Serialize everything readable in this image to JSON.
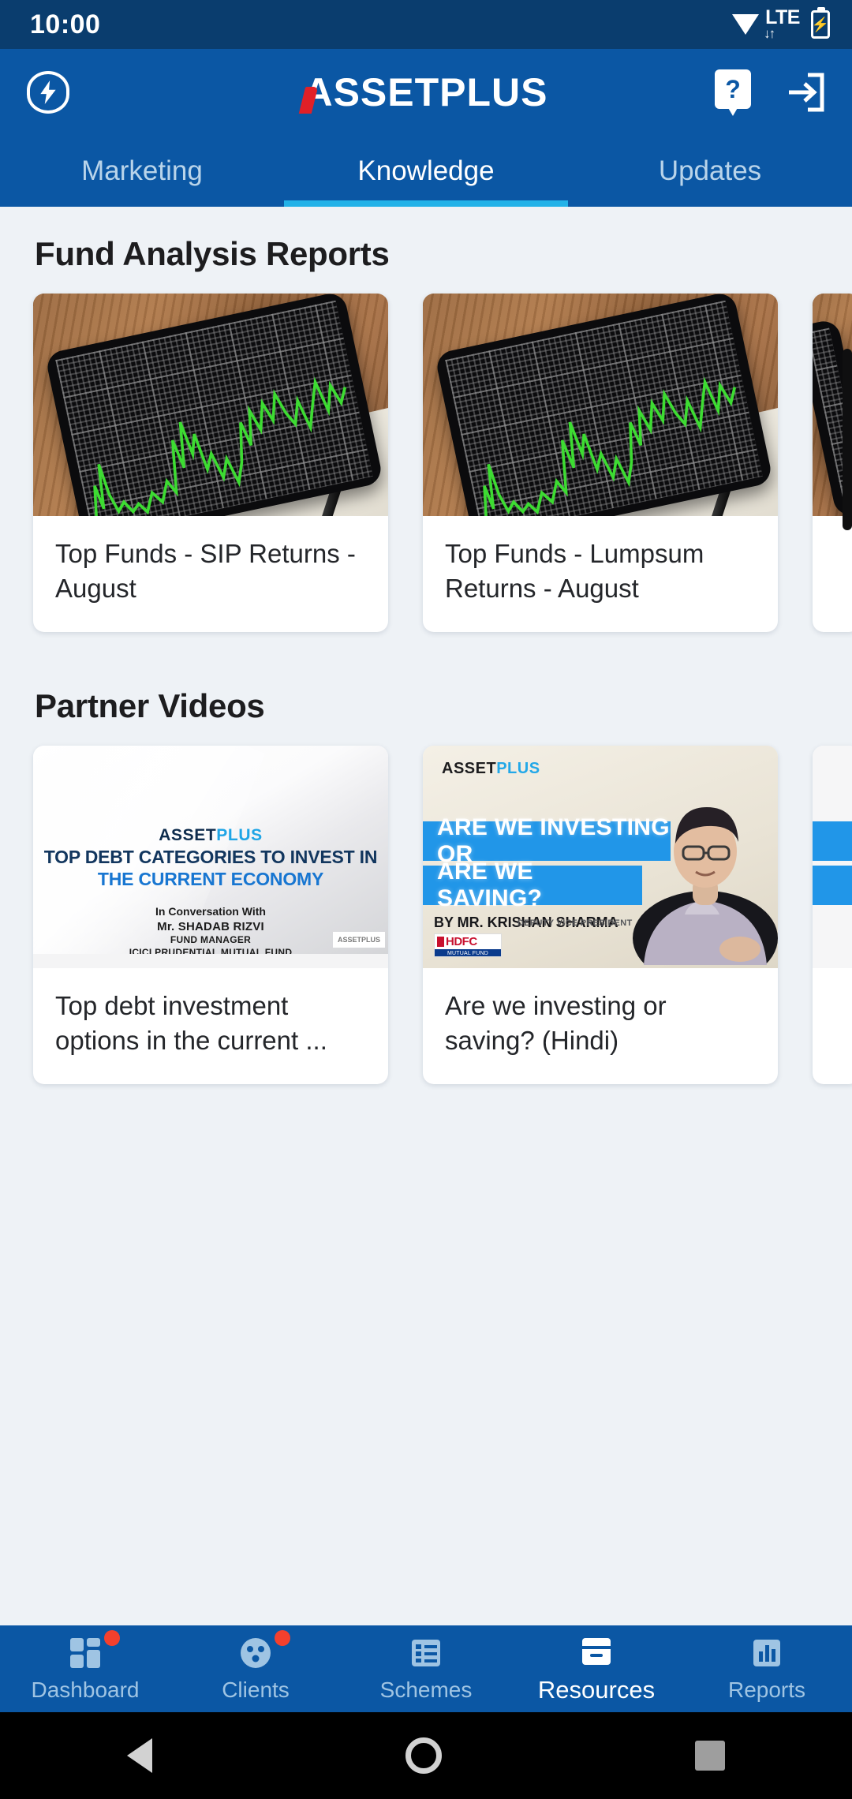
{
  "status_bar": {
    "time": "10:00",
    "network": "LTE",
    "wifi_icon": "wifi-icon",
    "battery_icon": "battery-charging-icon",
    "data_arrows": "↓↑"
  },
  "app_bar": {
    "menu_icon": "bolt-circle-icon",
    "brand_first": "ASSET",
    "brand_second": "PLUS",
    "brand_full": "ASSETPLUS",
    "help_icon": "help-question-icon",
    "help_label": "?",
    "logout_icon": "logout-icon"
  },
  "tabs": [
    {
      "label": "Marketing",
      "active": false
    },
    {
      "label": "Knowledge",
      "active": true
    },
    {
      "label": "Updates",
      "active": false
    }
  ],
  "sections": [
    {
      "title": "Fund Analysis Reports",
      "cards": [
        {
          "title": "Top Funds - SIP Returns - August",
          "thumb": "stock-chart-tablet-photo"
        },
        {
          "title": "Top Funds - Lumpsum Returns - August",
          "thumb": "stock-chart-tablet-photo"
        },
        {
          "title": "",
          "thumb": "stock-chart-tablet-photo"
        }
      ]
    },
    {
      "title": "Partner Videos",
      "cards": [
        {
          "title": "Top debt investment options in the current ...",
          "thumb": "video-slide-debt-categories",
          "slide": {
            "brand_a": "ASSET",
            "brand_p": "PLUS",
            "headline1": "TOP DEBT CATEGORIES TO INVEST IN",
            "headline2": "THE CURRENT ECONOMY",
            "credit_intro": "In Conversation With",
            "credit_name": "Mr. SHADAB RIZVI",
            "credit_role": "FUND MANAGER",
            "credit_org": "ICICI PRUDENTIAL MUTUAL FUND",
            "corner_logo": "ASSETPLUS"
          }
        },
        {
          "title": "Are we investing or saving? (Hindi)",
          "thumb": "video-slide-investing-saving",
          "slide": {
            "brand_a": "ASSET",
            "brand_p": "PLUS",
            "band1": "ARE WE INVESTING OR",
            "band2": "ARE WE SAVING?",
            "by_line": "BY MR. KRISHAN SHARMA",
            "designation": "DEPUTY VICE PRESIDENT",
            "logo_top": "HDFC",
            "logo_bottom": "MUTUAL FUND"
          }
        },
        {
          "title": "",
          "thumb": "video-slide-partial"
        }
      ]
    }
  ],
  "bottom_nav": [
    {
      "label": "Dashboard",
      "icon": "dashboard-grid-icon",
      "active": false,
      "badge": true
    },
    {
      "label": "Clients",
      "icon": "clients-people-icon",
      "active": false,
      "badge": true
    },
    {
      "label": "Schemes",
      "icon": "schemes-list-icon",
      "active": false,
      "badge": false
    },
    {
      "label": "Resources",
      "icon": "resources-archive-icon",
      "active": true,
      "badge": false
    },
    {
      "label": "Reports",
      "icon": "reports-bar-chart-icon",
      "active": false,
      "badge": false
    }
  ],
  "android_nav": {
    "back": "back-triangle-icon",
    "home": "home-circle-icon",
    "recents": "recents-square-icon"
  },
  "colors": {
    "status_bar": "#0a3d6e",
    "app_bar": "#0b57a4",
    "accent": "#22b2e8",
    "brand_red": "#e02027",
    "page_bg": "#eef2f6",
    "card_bg": "#ffffff",
    "badge": "#f4402d"
  }
}
